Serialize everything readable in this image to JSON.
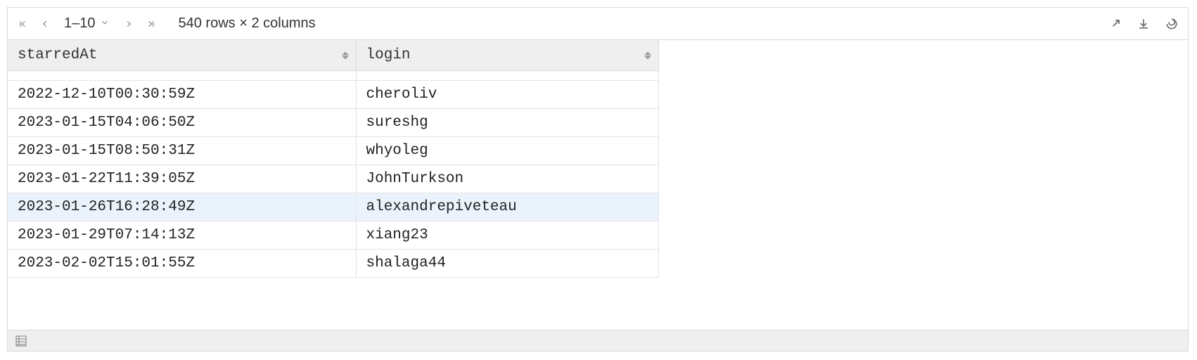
{
  "toolbar": {
    "page_range": "1–10",
    "rows_info": "540 rows × 2 columns"
  },
  "table": {
    "columns": [
      {
        "key": "starredAt",
        "label": "starredAt"
      },
      {
        "key": "login",
        "label": "login"
      }
    ],
    "rows": [
      {
        "starredAt": "",
        "login": "",
        "partial": true
      },
      {
        "starredAt": "2022-12-10T00:30:59Z",
        "login": "cheroliv"
      },
      {
        "starredAt": "2023-01-15T04:06:50Z",
        "login": "sureshg"
      },
      {
        "starredAt": "2023-01-15T08:50:31Z",
        "login": "whyoleg"
      },
      {
        "starredAt": "2023-01-22T11:39:05Z",
        "login": "JohnTurkson"
      },
      {
        "starredAt": "2023-01-26T16:28:49Z",
        "login": "alexandrepiveteau",
        "highlighted": true
      },
      {
        "starredAt": "2023-01-29T07:14:13Z",
        "login": "xiang23"
      },
      {
        "starredAt": "2023-02-02T15:01:55Z",
        "login": "shalaga44"
      }
    ]
  }
}
